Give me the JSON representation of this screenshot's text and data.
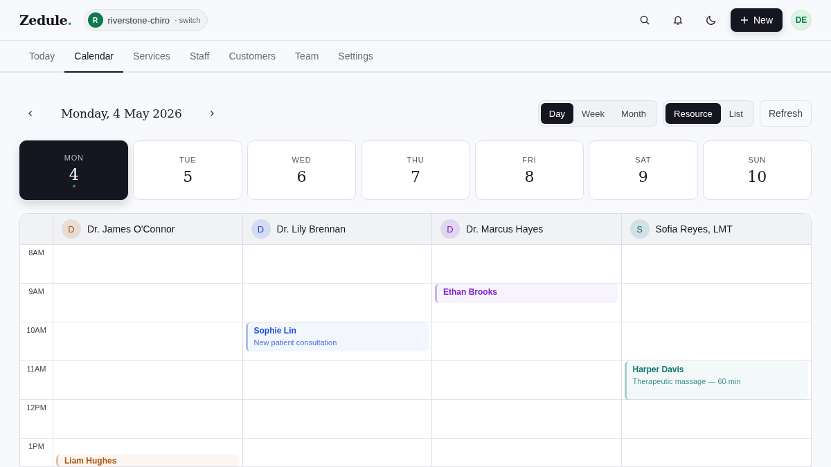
{
  "header": {
    "logo": "Zedule",
    "logo_dot": ".",
    "workspace": {
      "initial": "R",
      "name": "riverstone-chiro",
      "switch": "· switch"
    },
    "new_button": "New",
    "avatar": "DE"
  },
  "nav": [
    {
      "label": "Today",
      "selected": false
    },
    {
      "label": "Calendar",
      "selected": true
    },
    {
      "label": "Services",
      "selected": false
    },
    {
      "label": "Staff",
      "selected": false
    },
    {
      "label": "Customers",
      "selected": false
    },
    {
      "label": "Team",
      "selected": false
    },
    {
      "label": "Settings",
      "selected": false
    }
  ],
  "toolbar": {
    "date": "Monday, 4 May 2026",
    "views": [
      {
        "label": "Day",
        "selected": true
      },
      {
        "label": "Week",
        "selected": false
      },
      {
        "label": "Month",
        "selected": false
      }
    ],
    "modes": [
      {
        "label": "Resource",
        "selected": true
      },
      {
        "label": "List",
        "selected": false
      }
    ],
    "refresh": "Refresh"
  },
  "days": [
    {
      "weekday": "MON",
      "date": "4",
      "selected": true,
      "today": true
    },
    {
      "weekday": "TUE",
      "date": "5",
      "selected": false,
      "today": false
    },
    {
      "weekday": "WED",
      "date": "6",
      "selected": false,
      "today": false
    },
    {
      "weekday": "THU",
      "date": "7",
      "selected": false,
      "today": false
    },
    {
      "weekday": "FRI",
      "date": "8",
      "selected": false,
      "today": false
    },
    {
      "weekday": "SAT",
      "date": "9",
      "selected": false,
      "today": false
    },
    {
      "weekday": "SUN",
      "date": "10",
      "selected": false,
      "today": false
    }
  ],
  "resources": [
    {
      "initial": "D",
      "name": "Dr. James O'Connor",
      "color": "#b45309"
    },
    {
      "initial": "D",
      "name": "Dr. Lily Brennan",
      "color": "#1d4ed8"
    },
    {
      "initial": "D",
      "name": "Dr. Marcus Hayes",
      "color": "#7e22ce"
    },
    {
      "initial": "S",
      "name": "Sofia Reyes, LMT",
      "color": "#0f766e"
    }
  ],
  "rows": [
    {
      "time": "8AM",
      "cells": [
        {},
        {},
        {},
        {}
      ]
    },
    {
      "time": "9AM",
      "cells": [
        {},
        {},
        {
          "event": {
            "name": "Ethan Brooks",
            "kind": "half",
            "color": "#7e22ce"
          }
        },
        {}
      ]
    },
    {
      "time": "10AM",
      "cells": [
        {},
        {
          "event": {
            "name": "Sophie Lin",
            "detail": "New patient consultation",
            "kind": "threequarter",
            "color": "#1d4ed8"
          }
        },
        {},
        {}
      ]
    },
    {
      "time": "11AM",
      "cells": [
        {},
        {},
        {},
        {
          "event": {
            "name": "Harper Davis",
            "detail": "Therapeutic massage — 60 min",
            "kind": "hour",
            "color": "#0f766e"
          }
        }
      ]
    },
    {
      "time": "12PM",
      "cells": [
        {},
        {},
        {},
        {}
      ]
    },
    {
      "time": "1PM",
      "cells": [
        {
          "event": {
            "name": "Liam Hughes",
            "kind": "latehalf",
            "color": "#b45309"
          }
        },
        {},
        {},
        {}
      ]
    }
  ]
}
